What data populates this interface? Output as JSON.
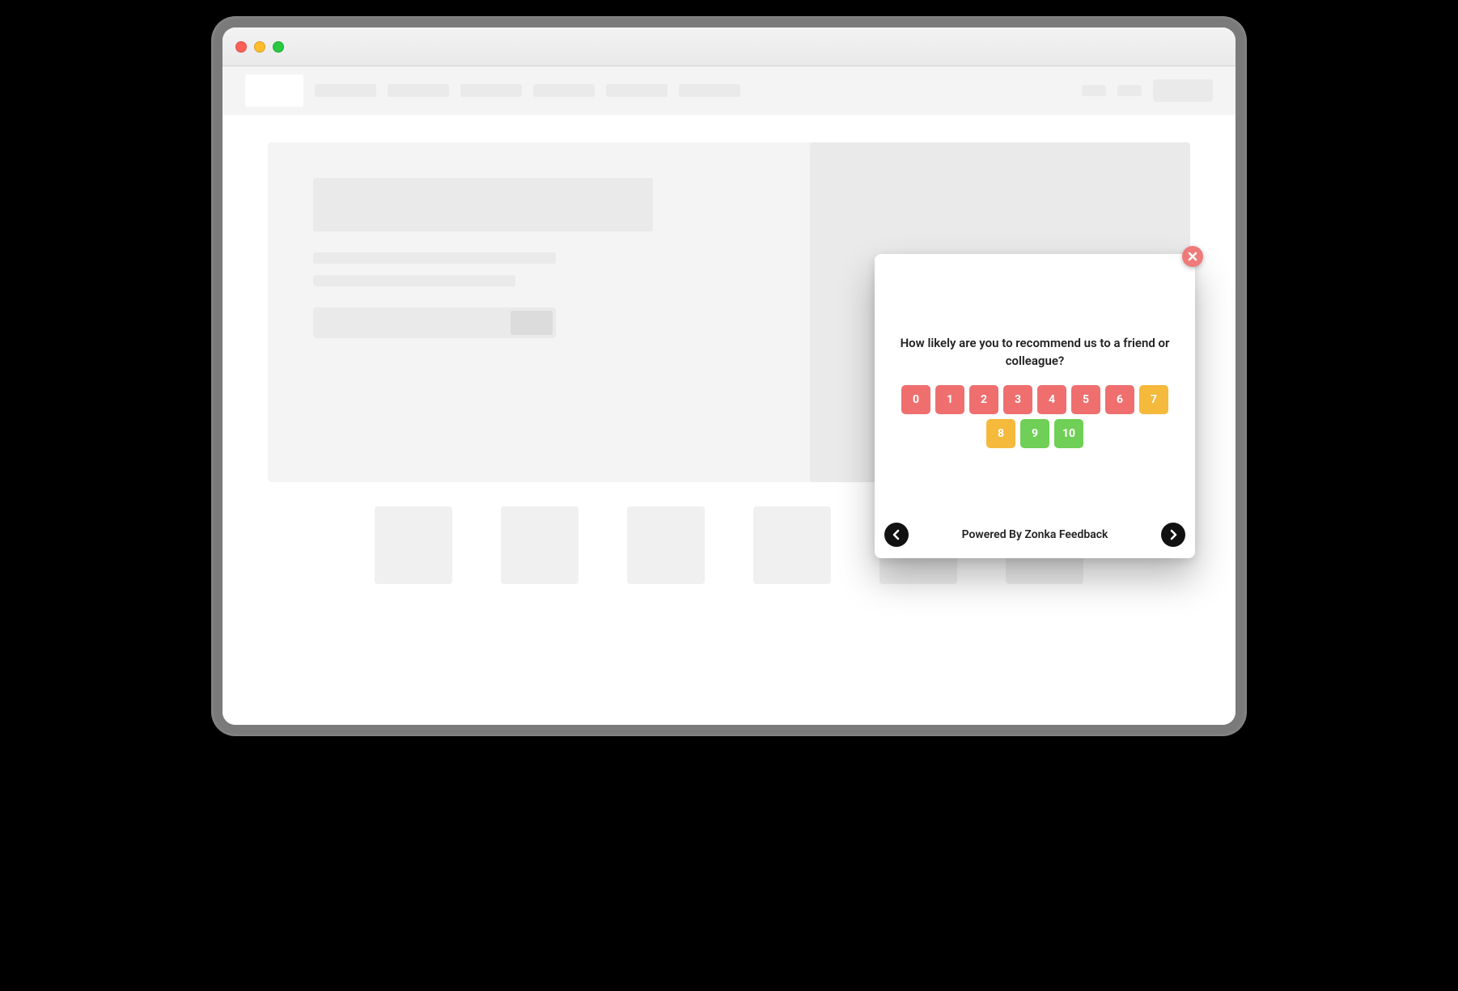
{
  "nps": {
    "question": "How likely are you to recommend us to a friend or colleague?",
    "options": [
      {
        "label": "0",
        "color": "#ef6f6f"
      },
      {
        "label": "1",
        "color": "#ef6f6f"
      },
      {
        "label": "2",
        "color": "#ef6f6f"
      },
      {
        "label": "3",
        "color": "#ef6f6f"
      },
      {
        "label": "4",
        "color": "#ef6f6f"
      },
      {
        "label": "5",
        "color": "#ef6f6f"
      },
      {
        "label": "6",
        "color": "#ef6f6f"
      },
      {
        "label": "7",
        "color": "#f5b93b"
      },
      {
        "label": "8",
        "color": "#f5b93b"
      },
      {
        "label": "9",
        "color": "#6fcf56"
      },
      {
        "label": "10",
        "color": "#6fcf56"
      }
    ],
    "powered_by": "Powered By Zonka Feedback"
  }
}
